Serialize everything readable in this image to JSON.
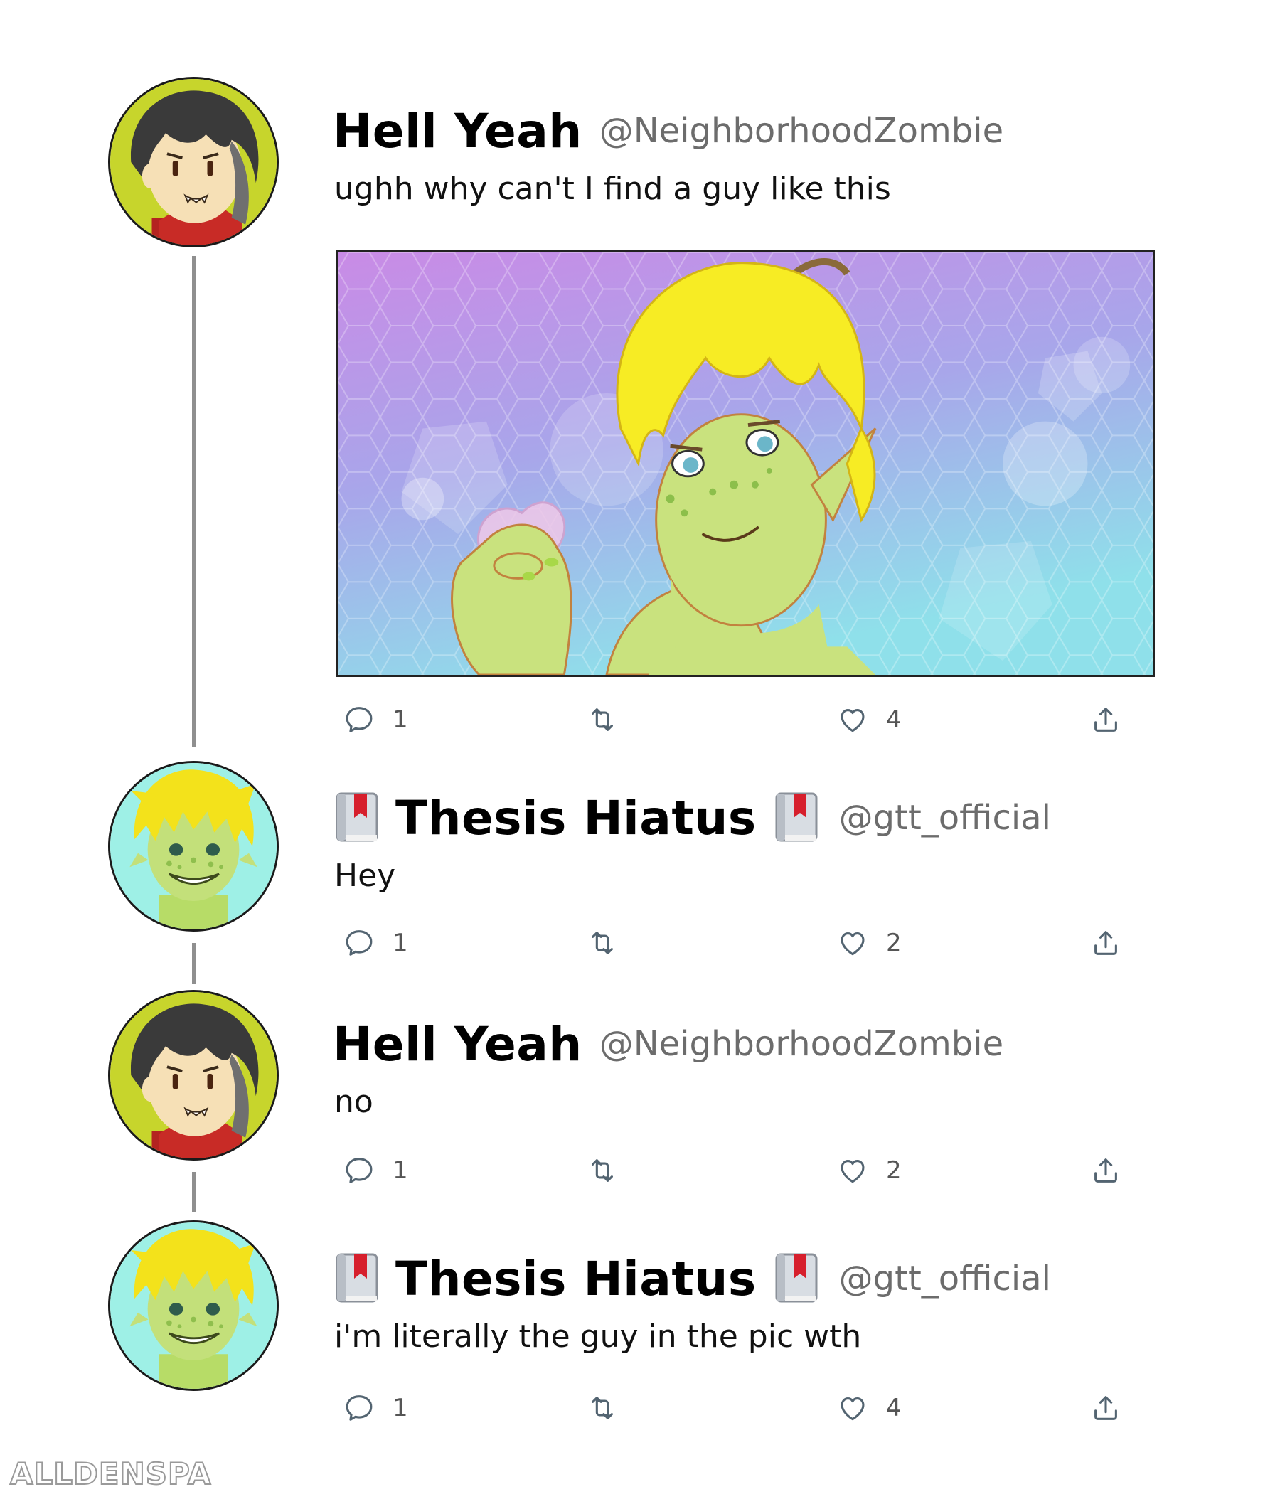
{
  "thread": [
    {
      "display_name": "Hell Yeah",
      "handle": "@NeighborhoodZombie",
      "text": "ughh why can't I find a guy like this",
      "has_media": true,
      "badges": false,
      "avatar": "dark-haired-vampire-avatar",
      "counts": {
        "replies": "1",
        "likes": "4"
      }
    },
    {
      "display_name": "Thesis Hiatus",
      "handle": "@gtt_official",
      "text": "Hey",
      "badges": true,
      "avatar": "blonde-green-elf-avatar",
      "counts": {
        "replies": "1",
        "likes": "2"
      }
    },
    {
      "display_name": "Hell Yeah",
      "handle": "@NeighborhoodZombie",
      "text": "no",
      "badges": false,
      "avatar": "dark-haired-vampire-avatar",
      "counts": {
        "replies": "1",
        "likes": "2"
      }
    },
    {
      "display_name": "Thesis Hiatus",
      "handle": "@gtt_official",
      "text": "i'm literally the guy in the pic wth",
      "badges": true,
      "avatar": "blonde-green-elf-avatar",
      "counts": {
        "replies": "1",
        "likes": "4"
      }
    }
  ],
  "icons": {
    "reply": "speech-bubble-icon",
    "retweet": "retweet-icon",
    "like": "heart-icon",
    "share": "share-upload-icon",
    "badge": "book-bookmark-icon"
  },
  "colors": {
    "name": "#000000",
    "handle": "#6c6c6c",
    "icon": "#536471",
    "thread_line": "#8f8f8f"
  },
  "watermark": "ALLDENSPA"
}
